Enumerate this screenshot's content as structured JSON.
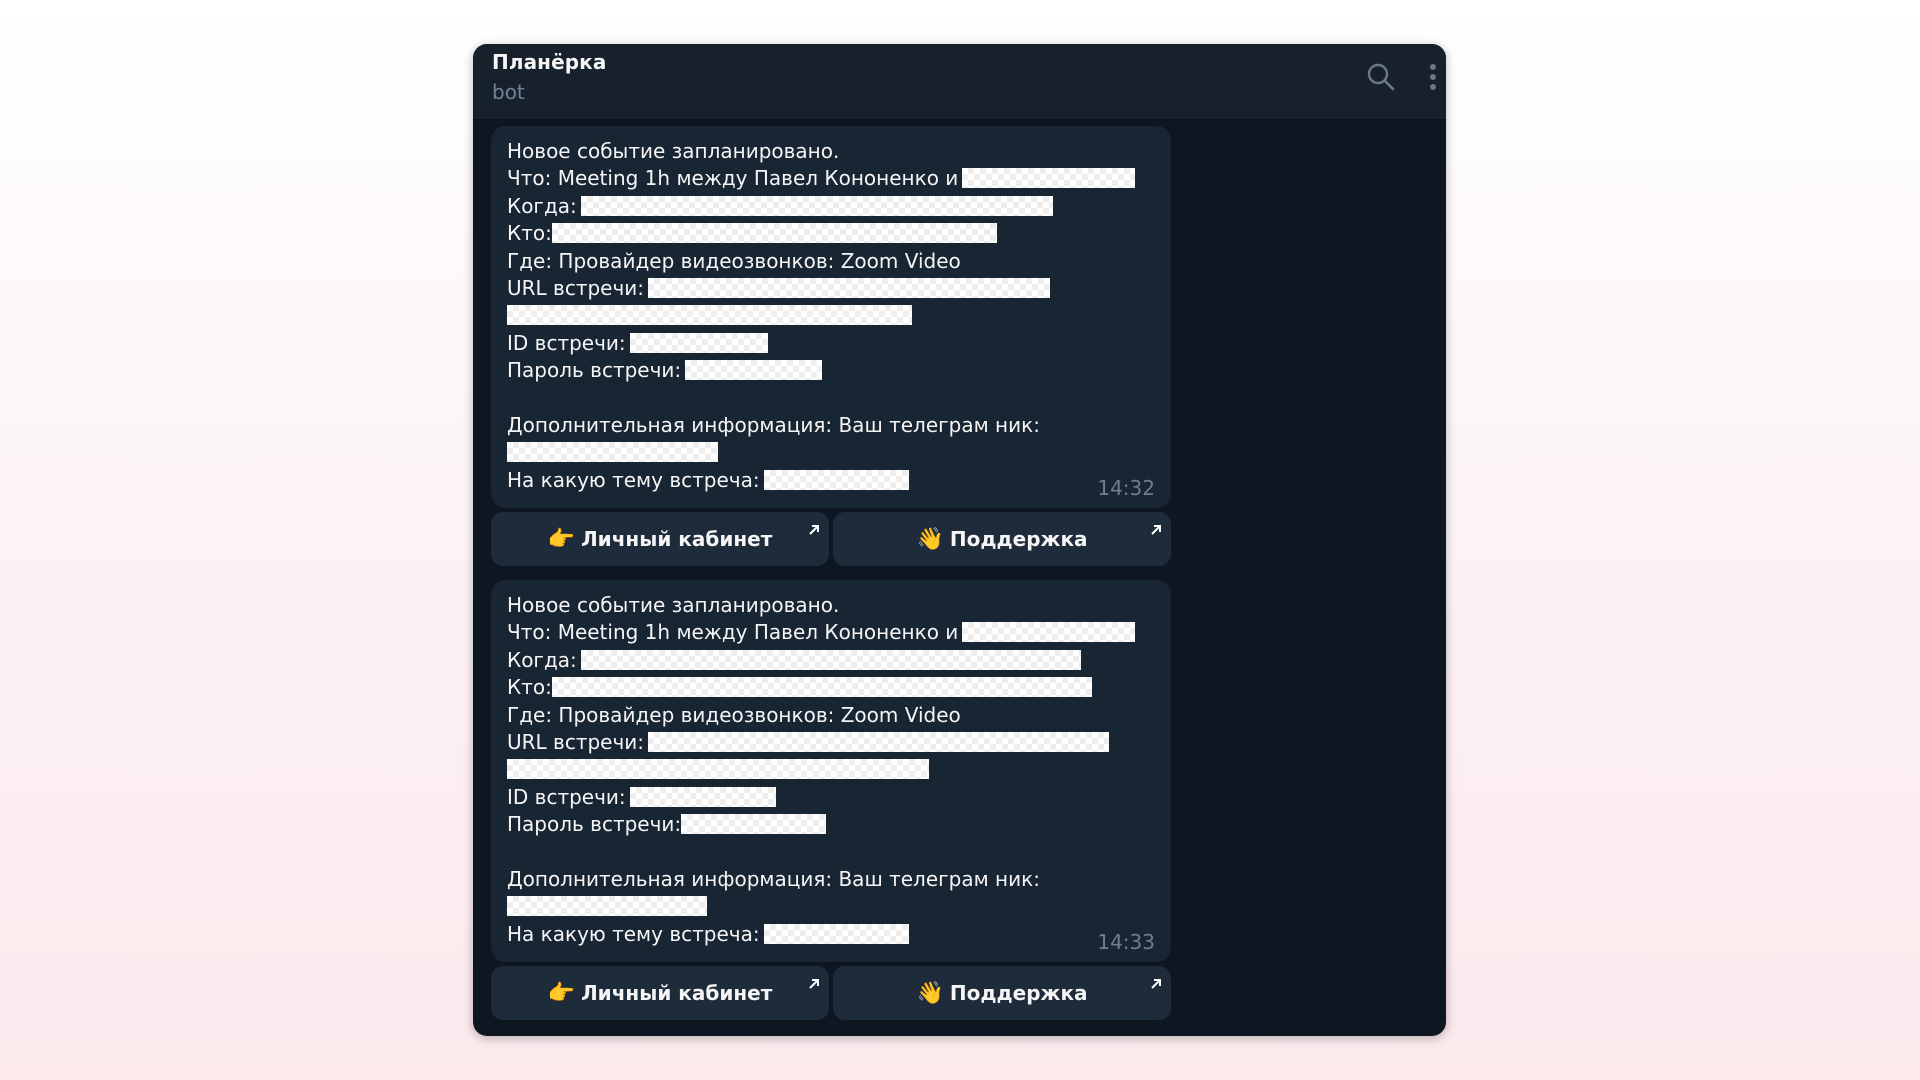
{
  "header": {
    "title": "Планёрка",
    "subtitle": "bot",
    "icons": [
      "search-icon",
      "more-vertical-icon"
    ]
  },
  "labels": {
    "announce": "Новое событие запланировано.",
    "what": "Что: Meeting 1h между Павел Кононенко и",
    "when": "Когда:",
    "who": "Кто:",
    "where": "Где: Провайдер видеозвонков: Zoom Video",
    "url": "URL встречи:",
    "id": "ID встречи:",
    "password": "Пароль встречи:",
    "extra": "Дополнительная информация: Ваш телеграм ник:",
    "topic": "На какую тему встреча:"
  },
  "messages": [
    {
      "time": "14:32"
    },
    {
      "time": "14:33"
    }
  ],
  "buttons": {
    "cabinet": {
      "emoji": "👉",
      "label": "Личный кабинет",
      "icon": "external-link-arrow-icon"
    },
    "support": {
      "emoji": "👋",
      "label": "Поддержка",
      "icon": "external-link-arrow-icon"
    }
  },
  "colors": {
    "window_bg": "#0e1621",
    "header_bg": "#17212b",
    "bubble_bg": "#182533",
    "button_bg": "#1d2b3b",
    "text": "#f5f5f5",
    "muted": "#708499"
  }
}
